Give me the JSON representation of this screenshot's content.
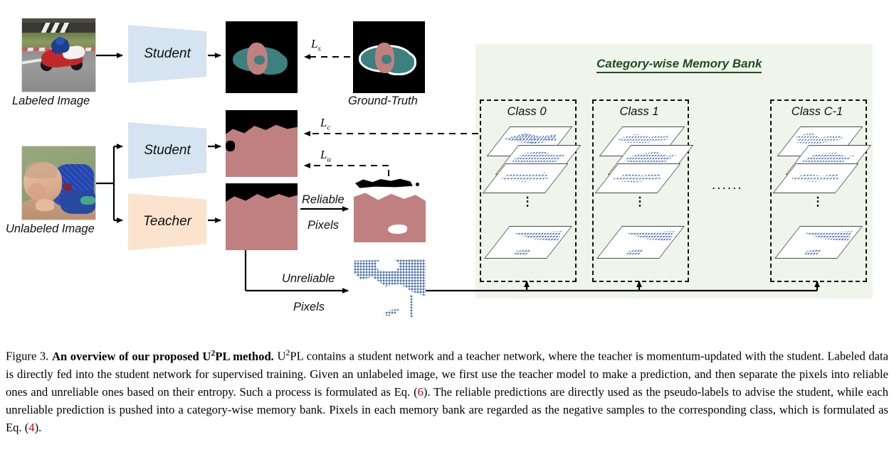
{
  "figure": {
    "number": "Figure 3.",
    "bold_title": "An overview of our proposed U2PL method.",
    "caption_parts": {
      "p1": "U",
      "p1sup": "2",
      "p1b": "PL contains a student network and a teacher network, where the teacher is momentum-updated with the student. Labeled data is directly fed into the student network for supervised training. Given an unlabeled image, we first use the teacher model to make a prediction, and then separate the pixels into reliable ones and unreliable ones based on their entropy. Such a process is formulated as Eq. (",
      "eq6": "6",
      "p2": "). The reliable predictions are directly used as the pseudo-labels to advise the student, while each unreliable prediction is pushed into a category-wise memory bank. Pixels in each memory bank are regarded as the negative samples to the corresponding class, which is formulated as Eq. (",
      "eq4": "4",
      "p3": ")."
    },
    "title_prefix": "An overview of our proposed U",
    "title_sup": "2",
    "title_suffix": "PL method."
  },
  "diagram": {
    "labels": {
      "labeled_image": "Labeled Image",
      "unlabeled_image": "Unlabeled Image",
      "ground_truth": "Ground-Truth",
      "student_top": "Student",
      "student_bottom": "Student",
      "teacher": "Teacher",
      "reliable_line1": "Reliable",
      "reliable_line2": "Pixels",
      "unreliable_line1": "Unreliable",
      "unreliable_line2": "Pixels"
    },
    "losses": {
      "supervised": "L",
      "supervised_sub": "s",
      "contrastive": "L",
      "contrastive_sub": "c",
      "unsupervised": "L",
      "unsupervised_sub": "u"
    },
    "memory_bank": {
      "title": "Category-wise Memory Bank",
      "classes": [
        {
          "label": "Class 0"
        },
        {
          "label": "Class 1"
        },
        {
          "label": "Class C-1"
        }
      ],
      "between_ellipsis": "......",
      "vertical_ellipsis": "⋮"
    },
    "colors": {
      "student_fill": "#d6e3f0",
      "teacher_fill": "#fbe3ce",
      "bank_bg": "#eff5ea",
      "bank_title": "#1f4d1f",
      "seg_pink": "#c08080",
      "seg_teal": "#3d8080",
      "seg_black": "#000000",
      "unreliable_blue": "#4a6fb0",
      "eq_ref_red": "#cc0000"
    }
  }
}
